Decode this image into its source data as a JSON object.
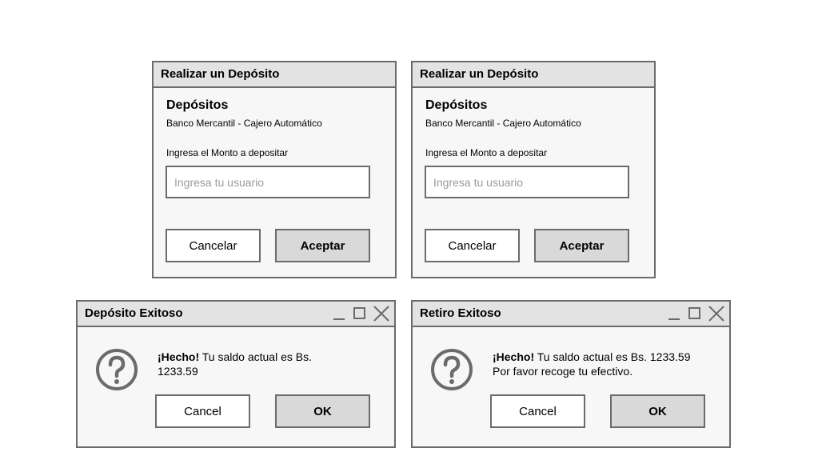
{
  "deposit_dialog_1": {
    "title": "Realizar un Depósito",
    "heading": "Depósitos",
    "subtitle": "Banco Mercantil - Cajero Automático",
    "amount_label": "Ingresa el Monto a depositar",
    "input_placeholder": "Ingresa tu usuario",
    "cancel_label": "Cancelar",
    "accept_label": "Aceptar"
  },
  "deposit_dialog_2": {
    "title": "Realizar un Depósito",
    "heading": "Depósitos",
    "subtitle": "Banco Mercantil - Cajero Automático",
    "amount_label": "Ingresa el Monto a depositar",
    "input_placeholder": "Ingresa tu usuario",
    "cancel_label": "Cancelar",
    "accept_label": "Aceptar"
  },
  "deposit_success": {
    "title": "Depósito Exitoso",
    "message_bold": "¡Hecho!",
    "message": " Tu saldo actual es Bs. 1233.59",
    "cancel_label": "Cancel",
    "ok_label": "OK",
    "icon": "question-mark-icon"
  },
  "withdraw_success": {
    "title": "Retiro Exitoso",
    "message_bold": "¡Hecho!",
    "message": " Tu saldo actual es Bs. 1233.59 Por favor recoge tu efectivo.",
    "cancel_label": "Cancel",
    "ok_label": "OK",
    "icon": "question-mark-icon"
  }
}
